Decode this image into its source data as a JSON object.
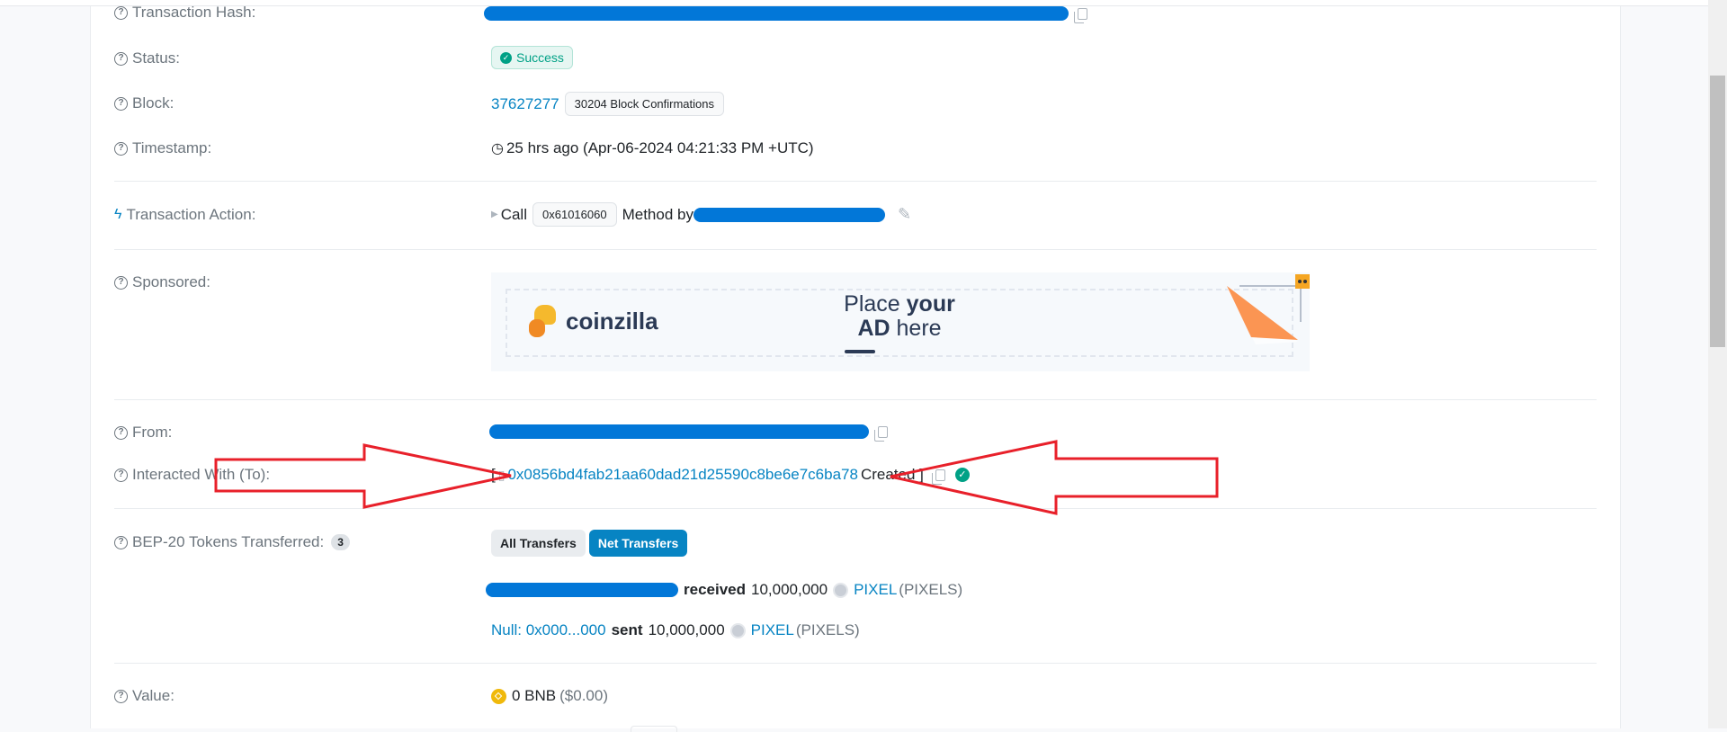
{
  "labels": {
    "tx_hash": "Transaction Hash:",
    "status": "Status:",
    "block": "Block:",
    "timestamp": "Timestamp:",
    "tx_action": "Transaction Action:",
    "sponsored": "Sponsored:",
    "from": "From:",
    "interacted_with": "Interacted With (To):",
    "bep20": "BEP-20 Tokens Transferred:",
    "value": "Value:"
  },
  "status": {
    "text": "Success",
    "color": "#00a186"
  },
  "block": {
    "number": "37627277",
    "confirmations": "30204 Block Confirmations"
  },
  "timestamp": "25 hrs ago (Apr-06-2024 04:21:33 PM +UTC)",
  "tx_action": {
    "call": "Call",
    "method": "0x61016060",
    "method_by": "Method by"
  },
  "sponsored_ad": {
    "brand": "coinzilla",
    "line1_a": "Place ",
    "line1_b": "your",
    "line2_a": "AD",
    "line2_b": " here"
  },
  "interacted_with": {
    "open_bracket": "[",
    "address": "0x0856bd4fab21aa60dad21d25590c8be6e7c6ba78",
    "created": "Created ]"
  },
  "bep20": {
    "count": "3",
    "tabs": [
      {
        "label": "All Transfers",
        "active": false
      },
      {
        "label": "Net Transfers",
        "active": true
      }
    ],
    "transfers": [
      {
        "from": "",
        "action": "received",
        "amount": "10,000,000",
        "token": "PIXEL",
        "symbol": "(PIXELS)"
      },
      {
        "from": "Null: 0x000...000",
        "action": "sent",
        "amount": "10,000,000",
        "token": "PIXEL",
        "symbol": "(PIXELS)"
      }
    ]
  },
  "value": {
    "amount": "0 BNB",
    "usd": "($0.00)"
  },
  "colors": {
    "link": "#0784c3",
    "redaction": "#0277d8",
    "annotation": "#e8202a",
    "primary": "#0784c3"
  }
}
